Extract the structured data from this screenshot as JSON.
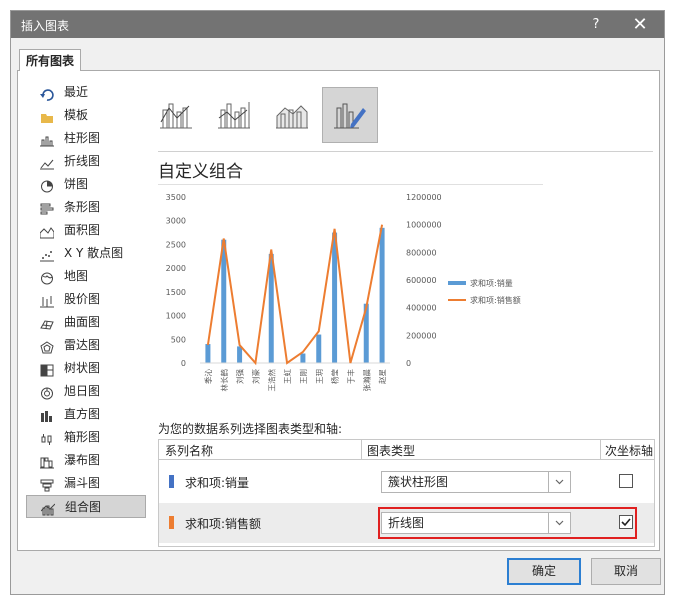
{
  "window": {
    "title": "插入图表",
    "help": "?",
    "close": "✕"
  },
  "tab": {
    "label": "所有图表"
  },
  "sidebar": {
    "items": [
      {
        "label": "最近",
        "icon": "recent-icon"
      },
      {
        "label": "模板",
        "icon": "folder-icon"
      },
      {
        "label": "柱形图",
        "icon": "column-chart-icon"
      },
      {
        "label": "折线图",
        "icon": "line-chart-icon"
      },
      {
        "label": "饼图",
        "icon": "pie-chart-icon"
      },
      {
        "label": "条形图",
        "icon": "bar-chart-icon"
      },
      {
        "label": "面积图",
        "icon": "area-chart-icon"
      },
      {
        "label": "X Y 散点图",
        "icon": "scatter-chart-icon"
      },
      {
        "label": "地图",
        "icon": "map-chart-icon"
      },
      {
        "label": "股价图",
        "icon": "stock-chart-icon"
      },
      {
        "label": "曲面图",
        "icon": "surface-chart-icon"
      },
      {
        "label": "雷达图",
        "icon": "radar-chart-icon"
      },
      {
        "label": "树状图",
        "icon": "treemap-chart-icon"
      },
      {
        "label": "旭日图",
        "icon": "sunburst-chart-icon"
      },
      {
        "label": "直方图",
        "icon": "histogram-chart-icon"
      },
      {
        "label": "箱形图",
        "icon": "box-whisker-chart-icon"
      },
      {
        "label": "瀑布图",
        "icon": "waterfall-chart-icon"
      },
      {
        "label": "漏斗图",
        "icon": "funnel-chart-icon"
      },
      {
        "label": "组合图",
        "icon": "combo-chart-icon"
      }
    ],
    "selected": "组合图"
  },
  "main": {
    "heading": "自定义组合",
    "instruction": "为您的数据系列选择图表类型和轴:",
    "table": {
      "headers": {
        "series": "系列名称",
        "chart_type": "图表类型",
        "secondary_axis": "次坐标轴"
      },
      "rows": [
        {
          "name": "求和项:销量",
          "chart_type": "簇状柱形图",
          "secondary": false,
          "color": "#4472c4"
        },
        {
          "name": "求和项:销售额",
          "chart_type": "折线图",
          "secondary": true,
          "color": "#ed7d31"
        }
      ]
    }
  },
  "buttons": {
    "ok": "确定",
    "cancel": "取消"
  },
  "colors": {
    "bar": "#5b9bd5",
    "line": "#ed7d31",
    "highlight": "#e02020"
  },
  "chart_data": {
    "type": "bar",
    "title": "",
    "categories": [
      "季沁",
      "林长鹤",
      "刘强",
      "刘豪",
      "王浩然",
      "王虹",
      "王刚",
      "王玥",
      "杨莹",
      "于丰",
      "张瀚晨",
      "赵星"
    ],
    "series": [
      {
        "name": "求和项:销量",
        "type": "bar",
        "axis": "primary",
        "values": [
          400,
          2600,
          350,
          0,
          2300,
          0,
          200,
          600,
          2750,
          0,
          1250,
          2850
        ]
      },
      {
        "name": "求和项:销售额",
        "type": "line",
        "axis": "secondary",
        "values": [
          130000,
          900000,
          130000,
          0,
          820000,
          0,
          80000,
          230000,
          970000,
          0,
          400000,
          1000000
        ]
      }
    ],
    "y_primary": {
      "min": 0,
      "max": 3500,
      "ticks": [
        "0",
        "500",
        "1000",
        "1500",
        "2000",
        "2500",
        "3000",
        "3500"
      ]
    },
    "y_secondary": {
      "min": 0,
      "max": 1200000,
      "ticks": [
        "0",
        "200000",
        "400000",
        "600000",
        "800000",
        "1000000",
        "1200000"
      ]
    },
    "legend": "right",
    "grid": false
  }
}
